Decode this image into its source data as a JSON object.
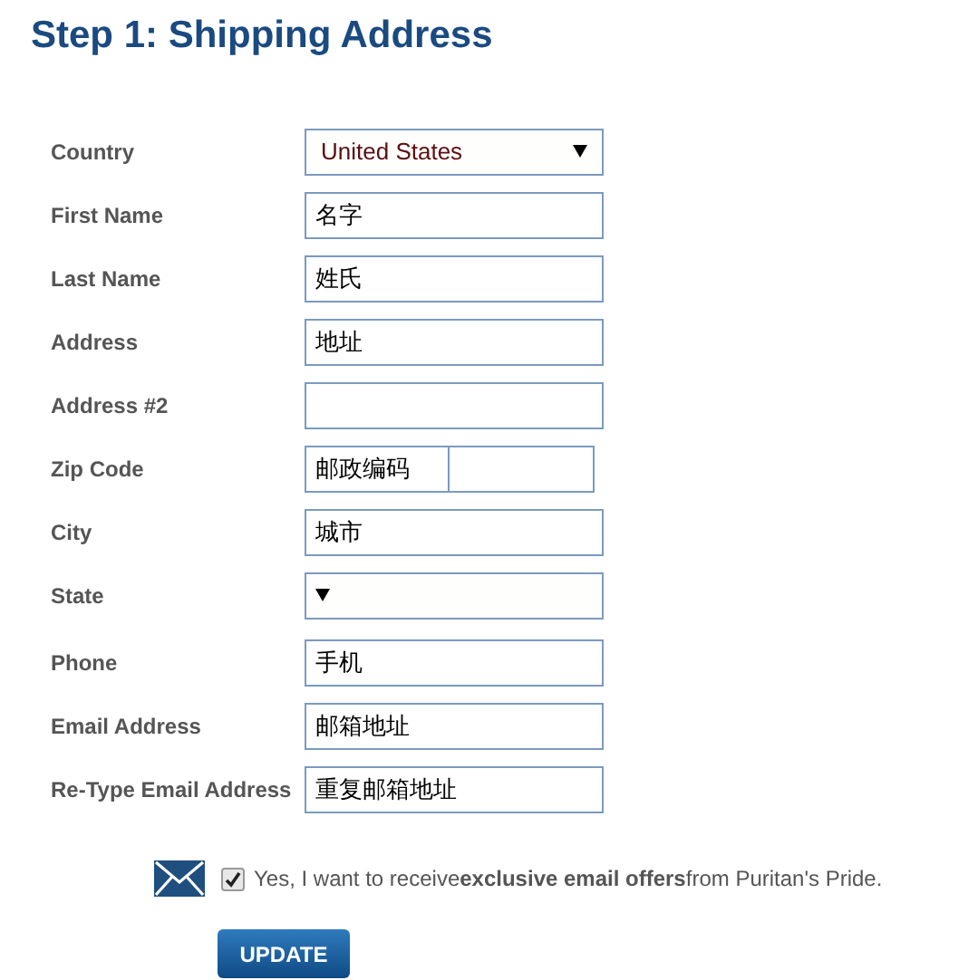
{
  "title": "Step 1: Shipping Address",
  "fields": [
    {
      "label": "Country",
      "kind": "select",
      "value": "United States"
    },
    {
      "label": "First Name",
      "kind": "text",
      "value": "名字"
    },
    {
      "label": "Last Name",
      "kind": "text",
      "value": "姓氏"
    },
    {
      "label": "Address",
      "kind": "text",
      "value": "地址"
    },
    {
      "label": "Address #2",
      "kind": "text"
    },
    {
      "label": "Zip Code",
      "kind": "zip",
      "value": "邮政编码"
    },
    {
      "label": "City",
      "kind": "text",
      "value": "城市"
    },
    {
      "label": "State",
      "kind": "select"
    },
    {
      "label": "Phone",
      "kind": "text",
      "value": "手机"
    },
    {
      "label": "Email Address",
      "kind": "text",
      "value": "邮箱地址"
    },
    {
      "label": "Re-Type Email Address",
      "kind": "text",
      "value": "重复邮箱地址"
    }
  ],
  "opt_in": {
    "checked": true,
    "text": "Yes, I want to receive**exclusive email offers**from Puritan's Pride."
  },
  "button": "UPDATE"
}
